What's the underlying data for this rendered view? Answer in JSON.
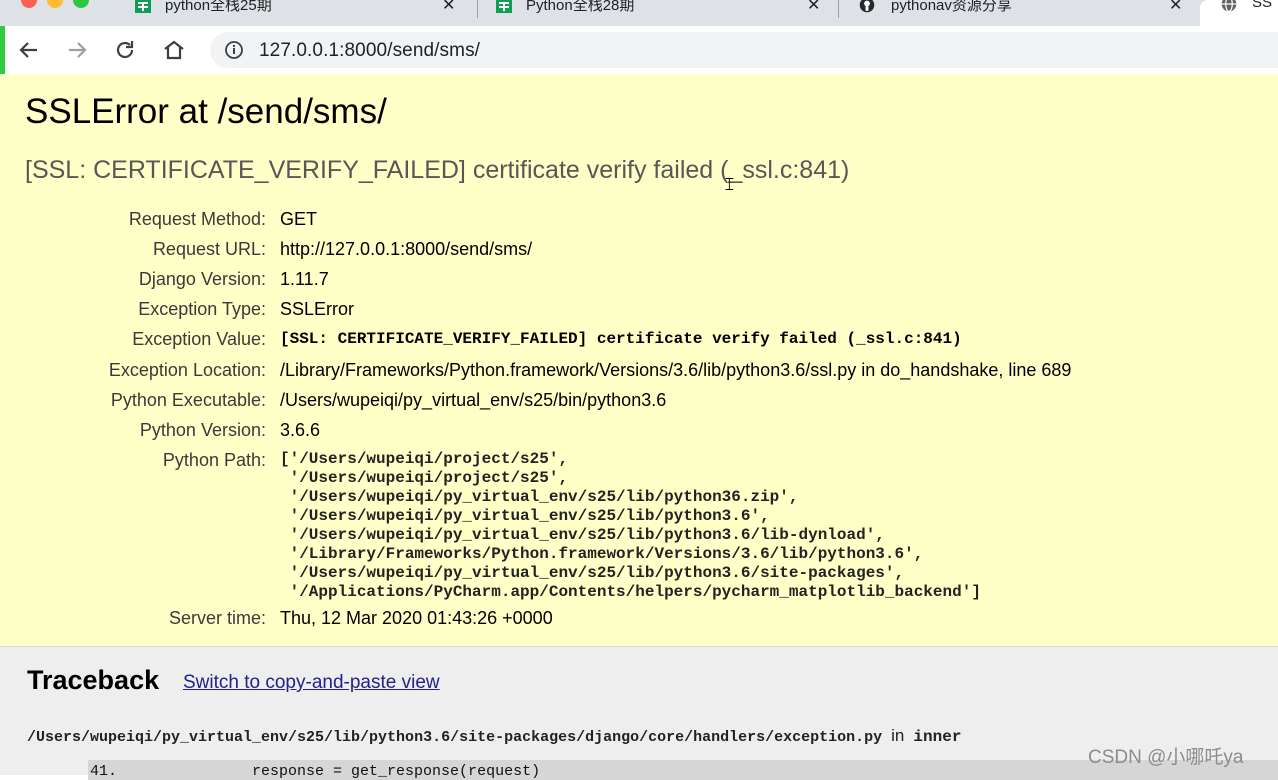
{
  "colors": {
    "summary_bg": "#ffffc8",
    "traceback_bg": "#eeeeee",
    "link": "#222288",
    "tab_strip": "#dee1e6",
    "accent_green": "#2ecc40"
  },
  "browser": {
    "tabs": [
      {
        "title": "python全栈25期",
        "icon": "sheets-icon",
        "close": "✕"
      },
      {
        "title": "Python全栈28期",
        "icon": "sheets-icon",
        "close": "✕"
      },
      {
        "title": "pythonav资源分享",
        "icon": "github-icon",
        "close": "✕"
      },
      {
        "title": "SS",
        "icon": "globe-icon"
      }
    ],
    "address": "127.0.0.1:8000/send/sms/"
  },
  "error": {
    "title": "SSLError at /send/sms/",
    "exception_value": "[SSL: CERTIFICATE_VERIFY_FAILED] certificate verify failed (_ssl.c:841)",
    "meta": [
      {
        "label": "Request Method:",
        "value": "GET"
      },
      {
        "label": "Request URL:",
        "value": "http://127.0.0.1:8000/send/sms/"
      },
      {
        "label": "Django Version:",
        "value": "1.11.7"
      },
      {
        "label": "Exception Type:",
        "value": "SSLError"
      },
      {
        "label": "Exception Value:",
        "value": "[SSL: CERTIFICATE_VERIFY_FAILED] certificate verify failed (_ssl.c:841)"
      },
      {
        "label": "Exception Location:",
        "value": "/Library/Frameworks/Python.framework/Versions/3.6/lib/python3.6/ssl.py in do_handshake, line 689"
      },
      {
        "label": "Python Executable:",
        "value": "/Users/wupeiqi/py_virtual_env/s25/bin/python3.6"
      },
      {
        "label": "Python Version:",
        "value": "3.6.6"
      },
      {
        "label": "Python Path:"
      },
      {
        "label": "Server time:",
        "value": "Thu, 12 Mar 2020 01:43:26 +0000"
      }
    ],
    "python_path": "['/Users/wupeiqi/project/s25',\n '/Users/wupeiqi/project/s25',\n '/Users/wupeiqi/py_virtual_env/s25/lib/python36.zip',\n '/Users/wupeiqi/py_virtual_env/s25/lib/python3.6',\n '/Users/wupeiqi/py_virtual_env/s25/lib/python3.6/lib-dynload',\n '/Library/Frameworks/Python.framework/Versions/3.6/lib/python3.6',\n '/Users/wupeiqi/py_virtual_env/s25/lib/python3.6/site-packages',\n '/Applications/PyCharm.app/Contents/helpers/pycharm_matplotlib_backend']"
  },
  "traceback": {
    "title": "Traceback",
    "switch_link": "Switch to copy-and-paste view",
    "file_path": "/Users/wupeiqi/py_virtual_env/s25/lib/python3.6/site-packages/django/core/handlers/exception.py",
    "in_word": "in",
    "function": "inner",
    "code_line": "41.               response = get_response(request)"
  },
  "watermark": "CSDN @小哪吒ya"
}
